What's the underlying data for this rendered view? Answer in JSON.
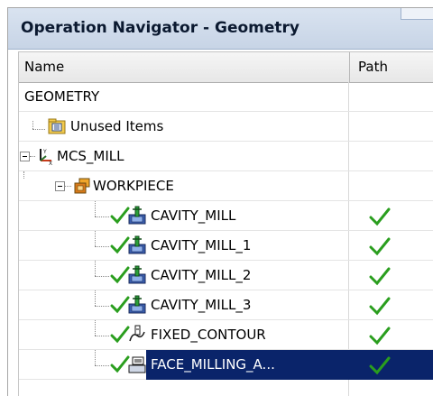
{
  "window": {
    "title": "Operation Navigator - Geometry"
  },
  "columns": {
    "name": "Name",
    "path": "Path"
  },
  "tree": [
    {
      "label": "GEOMETRY",
      "icon": "none"
    },
    {
      "label": "Unused Items",
      "icon": "unused-items-folder-icon"
    },
    {
      "label": "MCS_MILL",
      "icon": "mcs-axes-icon"
    },
    {
      "label": "WORKPIECE",
      "icon": "workpiece-icon"
    },
    {
      "label": "CAVITY_MILL",
      "icon": "cavity-mill-icon",
      "status": "complete",
      "path_ok": true
    },
    {
      "label": "CAVITY_MILL_1",
      "icon": "cavity-mill-icon",
      "status": "complete",
      "path_ok": true
    },
    {
      "label": "CAVITY_MILL_2",
      "icon": "cavity-mill-icon",
      "status": "complete",
      "path_ok": true
    },
    {
      "label": "CAVITY_MILL_3",
      "icon": "cavity-mill-icon",
      "status": "complete",
      "path_ok": true
    },
    {
      "label": "FIXED_CONTOUR",
      "icon": "fixed-contour-icon",
      "status": "complete",
      "path_ok": true
    },
    {
      "label": "FACE_MILLING_A...",
      "icon": "face-milling-icon",
      "status": "complete",
      "path_ok": true,
      "selected": true
    }
  ],
  "colors": {
    "selection": "#0a246a",
    "check_green": "#2a9e1e",
    "title_bg": "#c7d4e6"
  }
}
